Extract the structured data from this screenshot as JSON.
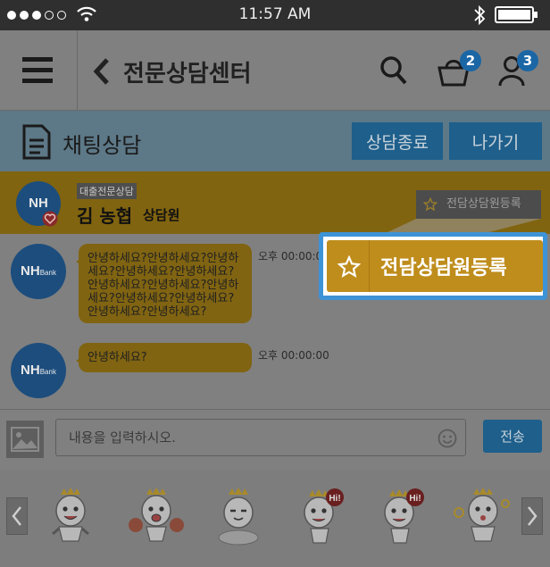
{
  "status_bar": {
    "time": "11:57 AM"
  },
  "header": {
    "title": "전문상담센터",
    "cart_count": "2",
    "user_count": "3"
  },
  "chat_title": {
    "label": "채팅상담",
    "end_button": "상담종료",
    "exit_button": "나가기"
  },
  "counselor": {
    "avatar_text": "NH",
    "tag": "대출전문상담",
    "name": "김 농협",
    "rank": "상담원",
    "register_label": "전담상담원등록"
  },
  "highlight": {
    "register_label": "전담상담원등록"
  },
  "messages": [
    {
      "avatar_text": "NH",
      "avatar_sub": "Bank",
      "text": "안녕하세요?안녕하세요?안녕하세요?안녕하세요?안녕하세요?안녕하세요?안녕하세요?안녕하세요?안녕하세요?안녕하세요?안녕하세요?안녕하세요?",
      "time": "오후 00:00:00"
    },
    {
      "avatar_text": "NH",
      "avatar_sub": "Bank",
      "text": "안녕하세요?",
      "time": "오후 00:00:00"
    }
  ],
  "input": {
    "placeholder": "내용을 입력하시오.",
    "send_button": "전송"
  },
  "stickers": {
    "count": 6,
    "hi_label": "Hi!"
  },
  "colors": {
    "accent_blue": "#3e93d6",
    "highlight_gold": "#bf8d1c",
    "badge_blue": "#1b66a5"
  },
  "icons": [
    "signal-dots-icon",
    "wifi-icon",
    "bluetooth-icon",
    "battery-icon",
    "menu-icon",
    "back-chevron-icon",
    "search-icon",
    "cart-icon",
    "user-icon",
    "document-icon",
    "heart-icon",
    "star-icon",
    "image-icon",
    "emoji-icon",
    "chevron-left-icon",
    "chevron-right-icon"
  ]
}
